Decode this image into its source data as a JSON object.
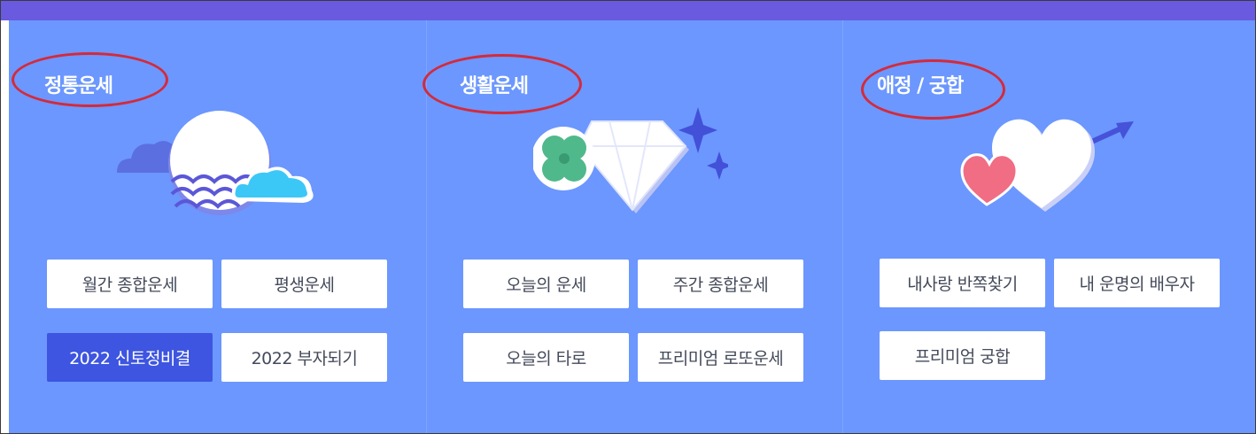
{
  "sections": [
    {
      "title": "정통운세",
      "buttons": [
        "월간 종합운세",
        "평생운세",
        "2022 신토정비결",
        "2022 부자되기"
      ]
    },
    {
      "title": "생활운세",
      "buttons": [
        "오늘의 운세",
        "주간 종합운세",
        "오늘의 타로",
        "프리미엄 로또운세"
      ]
    },
    {
      "title": "애정 / 궁합",
      "buttons": [
        "내사랑 반쪽찾기",
        "내 운명의 배우자",
        "프리미엄 궁합"
      ]
    }
  ],
  "colors": {
    "background": "#6b97fe",
    "top_bar": "#6a5ae0",
    "active_button": "#3d55e0",
    "annotation_oval": "#d42a3a"
  },
  "icons": [
    "moon-wave-cloud-icon",
    "clover-diamond-icon",
    "hearts-arrow-icon"
  ]
}
